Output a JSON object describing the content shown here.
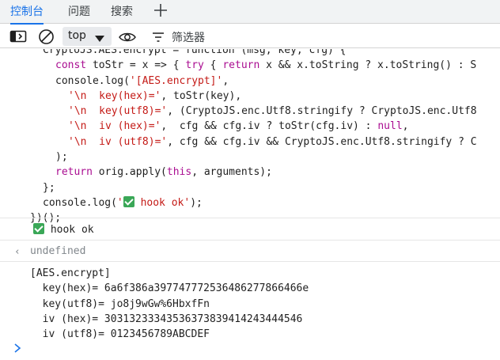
{
  "tabs": [
    {
      "label": "控制台",
      "active": true
    },
    {
      "label": "问题",
      "active": false
    },
    {
      "label": "搜索",
      "active": false
    }
  ],
  "toolbar": {
    "context": "top",
    "filter_placeholder": "筛选器"
  },
  "code": {
    "line0": "CryptoJS.AES.encrypt = function (msg, key, cfg) {",
    "line1_a": "const",
    "line1_b": " toStr = x => { ",
    "line1_c": "try",
    "line1_d": " { ",
    "line1_e": "return",
    "line1_f": " x && x.toString ? x.toString() : S",
    "line2_a": "console.log(",
    "line2_b": "'[AES.encrypt]'",
    "line2_c": ",",
    "line3_a": "'\\n  key(hex)='",
    "line3_b": ", toStr(key),",
    "line4_a": "'\\n  key(utf8)='",
    "line4_b": ", (CryptoJS.enc.Utf8.stringify ? CryptoJS.enc.Utf8",
    "line5_a": "'\\n  iv (hex)='",
    "line5_b": ",  cfg && cfg.iv ? toStr(cfg.iv) : ",
    "line5_c": "null",
    "line5_d": ",",
    "line6_a": "'\\n  iv (utf8)='",
    "line6_b": ", cfg && cfg.iv && CryptoJS.enc.Utf8.stringify ? C",
    "line7": ");",
    "line8_a": "return",
    "line8_b": " orig.apply(",
    "line8_c": "this",
    "line8_d": ", arguments);",
    "line9": "};",
    "line10_a": "console.log(",
    "line10_b": "'",
    "line10_c": " hook ok'",
    "line10_d": ");",
    "line11": "})();"
  },
  "log_hook": " hook ok",
  "result_value": "undefined",
  "output": {
    "l1": "[AES.encrypt]",
    "l2": "  key(hex)= 6a6f386a397747772536486277866466e",
    "l3": "  key(utf8)= jo8j9wGw%6HbxfFn",
    "l4": "  iv (hex)= 30313233343536373839414243444546",
    "l5": "  iv (utf8)= 0123456789ABCDEF"
  },
  "colors": {
    "accent": "#1a73e8",
    "check": "#3aa757",
    "keyword": "#aa0d91",
    "string": "#c41a16",
    "muted": "#80868b"
  }
}
